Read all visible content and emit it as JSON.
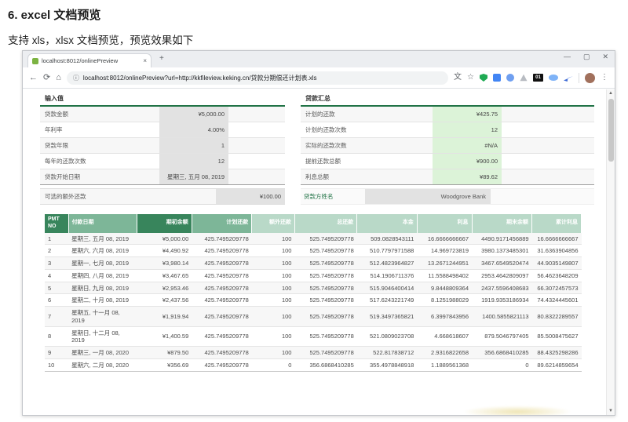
{
  "doc": {
    "heading": "6. excel 文档预览",
    "subtitle": "支持 xls，xlsx 文档预览，预览效果如下"
  },
  "browser": {
    "tab": {
      "title": "localhost:8012/onlinePreview",
      "close": "×"
    },
    "new_tab": "+",
    "controls": {
      "minimize": "—",
      "maximize": "▢",
      "close": "✕"
    },
    "nav": {
      "back": "←",
      "reload": "⟳",
      "home": "⌂"
    },
    "url": {
      "info": "ⓘ",
      "text": "localhost:8012/onlinePreview?url=http://kkfileview.keking.cn/贷款分期偿还计划表.xls"
    },
    "actions": {
      "translate": "文",
      "star": "☆",
      "menu": "⋮",
      "extension_badge": "01"
    }
  },
  "sheet": {
    "input": {
      "title": "输入值",
      "rows": [
        {
          "label": "贷款金额",
          "value": "¥5,000.00"
        },
        {
          "label": "年利率",
          "value": "4.00%"
        },
        {
          "label": "贷款年限",
          "value": "1"
        },
        {
          "label": "每年的还款次数",
          "value": "12"
        },
        {
          "label": "贷款开始日期",
          "value": "星期三, 五月 08, 2019"
        }
      ]
    },
    "summary": {
      "title": "贷款汇总",
      "rows": [
        {
          "label": "计划的还款",
          "value": "¥425.75"
        },
        {
          "label": "计划的还款次数",
          "value": "12"
        },
        {
          "label": "实际的还款次数",
          "value": "#N/A"
        },
        {
          "label": "提前还款总额",
          "value": "¥900.00"
        },
        {
          "label": "利息总额",
          "value": "¥89.62"
        }
      ]
    },
    "extra": {
      "label": "可选的额外还款",
      "value": "¥100.00",
      "lender_label": "贷款方姓名",
      "lender_value": "Woodgrove Bank"
    },
    "table": {
      "headers": [
        "PMT NO",
        "付款日期",
        "期初余额",
        "计划还款",
        "额外还款",
        "总还款",
        "本金",
        "利息",
        "期末余额",
        "累计利息"
      ],
      "rows": [
        [
          "1",
          "星期三, 五月 08, 2019",
          "¥5,000.00",
          "425.7495209778",
          "100",
          "525.7495209778",
          "509.0828543111",
          "16.6666666667",
          "4490.9171456889",
          "16.6666666667"
        ],
        [
          "2",
          "星期六, 六月 08, 2019",
          "¥4,490.92",
          "425.7495209778",
          "100",
          "525.7495209778",
          "510.7797971588",
          "14.969723819",
          "3980.1373485301",
          "31.6363904856"
        ],
        [
          "3",
          "星期一, 七月 08, 2019",
          "¥3,980.14",
          "425.7495209778",
          "100",
          "525.7495209778",
          "512.4823964827",
          "13.2671244951",
          "3467.6549520474",
          "44.9035149807"
        ],
        [
          "4",
          "星期四, 八月 08, 2019",
          "¥3,467.65",
          "425.7495209778",
          "100",
          "525.7495209778",
          "514.1906711376",
          "11.5588498402",
          "2953.4642809097",
          "56.4623648209"
        ],
        [
          "5",
          "星期日, 九月 08, 2019",
          "¥2,953.46",
          "425.7495209778",
          "100",
          "525.7495209778",
          "515.9046400414",
          "9.8448809364",
          "2437.5596408683",
          "66.3072457573"
        ],
        [
          "6",
          "星期二, 十月 08, 2019",
          "¥2,437.56",
          "425.7495209778",
          "100",
          "525.7495209778",
          "517.6243221749",
          "8.1251988029",
          "1919.9353186934",
          "74.4324445601"
        ],
        [
          "7",
          "星期五, 十一月 08, 2019",
          "¥1,919.94",
          "425.7495209778",
          "100",
          "525.7495209778",
          "519.3497365821",
          "6.3997843956",
          "1400.5855821113",
          "80.8322289557"
        ],
        [
          "8",
          "星期日, 十二月 08, 2019",
          "¥1,400.59",
          "425.7495209778",
          "100",
          "525.7495209778",
          "521.0809023708",
          "4.668618607",
          "879.5046797405",
          "85.5008475627"
        ],
        [
          "9",
          "星期三, 一月 08, 2020",
          "¥879.50",
          "425.7495209778",
          "100",
          "525.7495209778",
          "522.817838712",
          "2.9316822658",
          "356.6868410285",
          "88.4325298286"
        ],
        [
          "10",
          "星期六, 二月 08, 2020",
          "¥356.69",
          "425.7495209778",
          "0",
          "356.6868410285",
          "355.4978848918",
          "1.1889561368",
          "0",
          "89.6214859654"
        ]
      ]
    }
  },
  "colors": {
    "excel_dark_green": "#38855c",
    "excel_medium_green": "#7db698",
    "excel_light_green": "#b9d9c8",
    "green_value_cell": "#dcf3d8",
    "gray_value_cell": "#e2e2e2",
    "accent_border_green": "#217346"
  }
}
